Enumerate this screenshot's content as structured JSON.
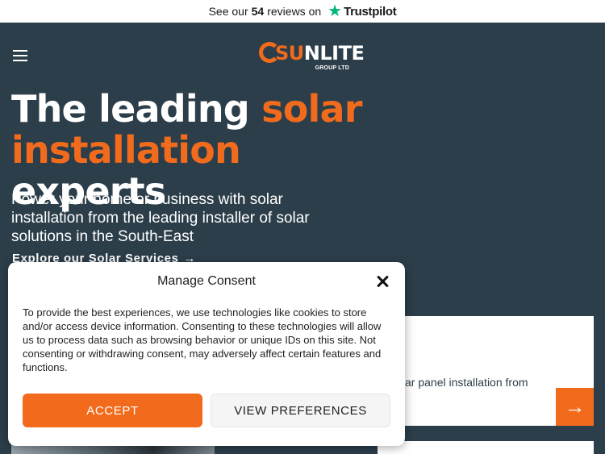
{
  "topbar": {
    "prefix": "See our",
    "count": "54",
    "suffix": "reviews on",
    "brand": "Trustpilot",
    "star_icon": "star-icon",
    "star_color": "#00b67a"
  },
  "header": {
    "menu_icon": "menu-icon",
    "logo": {
      "letter_s": "S",
      "letter_u": "U",
      "rest": "NLITE",
      "sub": "GROUP LTD"
    }
  },
  "hero": {
    "headline_part1": "The leading ",
    "headline_accent1": "solar",
    "headline_accent2": "installation",
    "headline_part2": " experts",
    "subtext": "Power your home or business with solar installation from the leading installer of solar solutions in the South-East",
    "explore_label": "Explore our Solar Services",
    "explore_arrow": "→"
  },
  "card": {
    "text": "ar panel installation from",
    "arrow": "→"
  },
  "consent": {
    "title": "Manage Consent",
    "body": "To provide the best experiences, we use technologies like cookies to store and/or access device information. Consenting to these technologies will allow us to process data such as browsing behavior or unique IDs on this site. Not consenting or withdrawing consent, may adversely affect certain features and functions.",
    "accept_label": "ACCEPT",
    "preferences_label": "VIEW PREFERENCES"
  },
  "colors": {
    "accent": "#f26b1d",
    "background": "#2c3e4a"
  }
}
